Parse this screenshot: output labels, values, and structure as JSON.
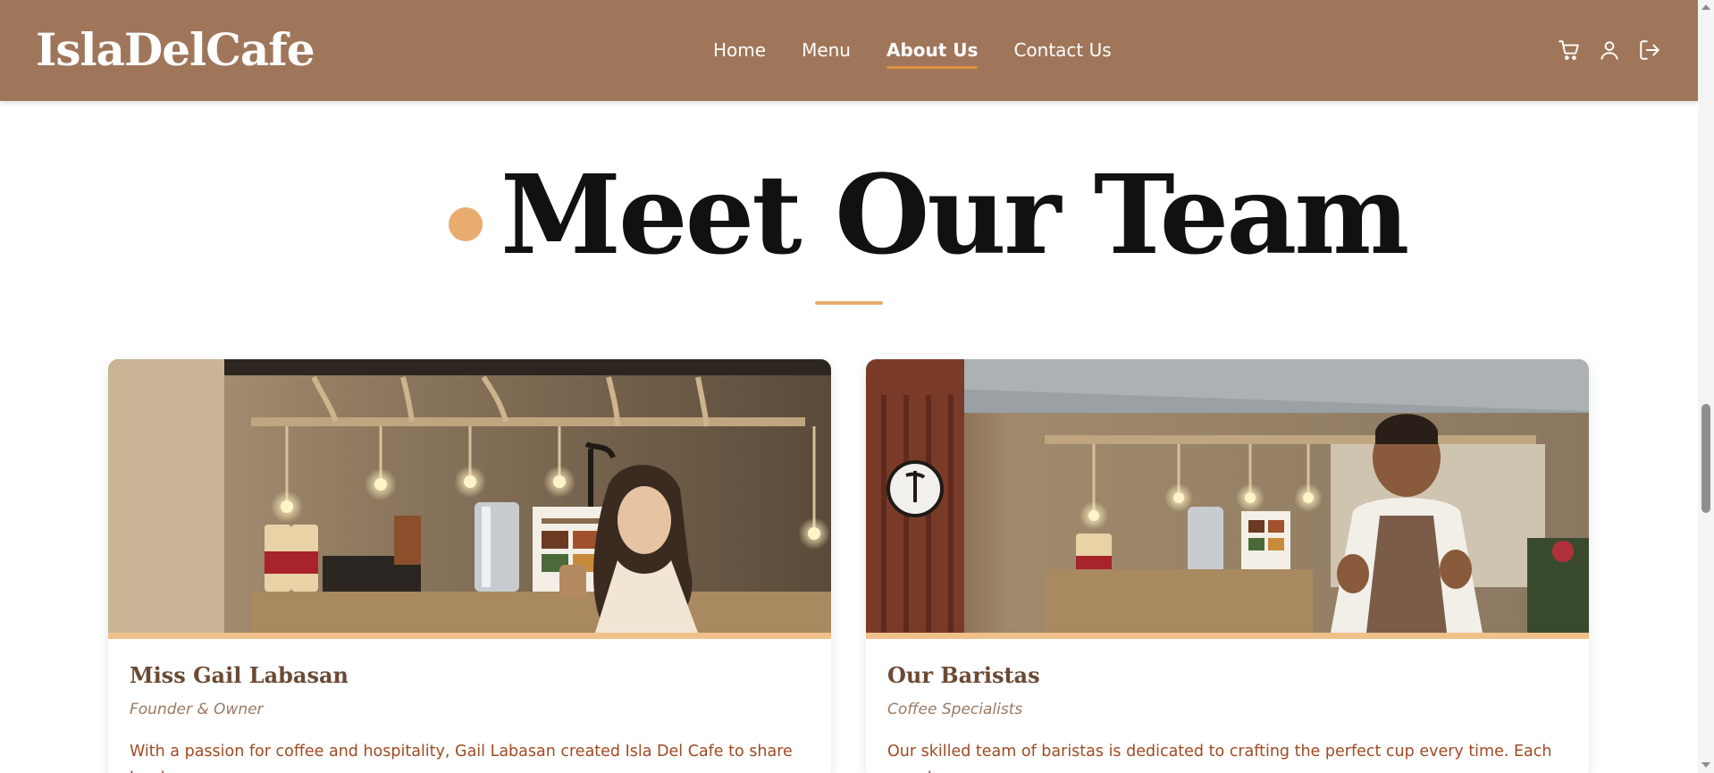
{
  "brand": "IslaDelCafe",
  "nav": {
    "links": [
      "Home",
      "Menu",
      "About Us",
      "Contact Us"
    ],
    "active": "About Us",
    "icons": [
      "cart-icon",
      "user-icon",
      "logout-icon"
    ]
  },
  "section": {
    "title": "Meet Our Team"
  },
  "team": [
    {
      "name": "Miss Gail Labasan",
      "role": "Founder & Owner",
      "description": "With a passion for coffee and hospitality, Gail Labasan created Isla Del Cafe to share her love"
    },
    {
      "name": "Our Baristas",
      "role": "Coffee Specialists",
      "description": "Our skilled team of baristas is dedicated to crafting the perfect cup every time. Each member"
    }
  ],
  "colors": {
    "navbar": "#a0765a",
    "accent": "#e8ac70",
    "nav_underline": "#e0923f",
    "heading": "#111111",
    "card_name": "#6b4a35",
    "card_role": "#9a7a62",
    "card_text": "#a04a22"
  }
}
